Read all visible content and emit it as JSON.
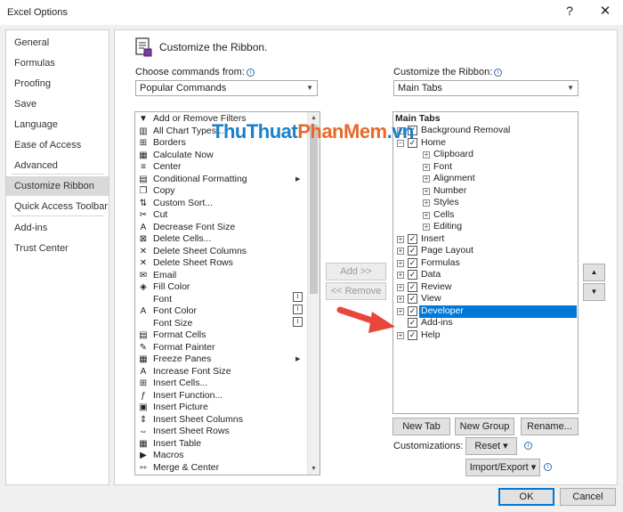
{
  "window": {
    "title": "Excel Options",
    "help_label": "?",
    "close_label": "✕"
  },
  "sidebar": {
    "items": [
      {
        "label": "General"
      },
      {
        "label": "Formulas"
      },
      {
        "label": "Proofing"
      },
      {
        "label": "Save"
      },
      {
        "label": "Language"
      },
      {
        "label": "Ease of Access"
      },
      {
        "label": "Advanced"
      },
      {
        "label": "Customize Ribbon"
      },
      {
        "label": "Quick Access Toolbar"
      },
      {
        "label": "Add-ins"
      },
      {
        "label": "Trust Center"
      }
    ],
    "selected": "Customize Ribbon"
  },
  "main": {
    "heading": "Customize the Ribbon.",
    "choose_label": "Choose commands from:",
    "choose_value": "Popular Commands",
    "customize_label": "Customize the Ribbon:",
    "customize_value": "Main Tabs",
    "commands": [
      {
        "icon": "filter-icon",
        "glyph": "▼",
        "label": "Add or Remove Filters"
      },
      {
        "icon": "chart-icon",
        "glyph": "▥",
        "label": "All Chart Types..."
      },
      {
        "icon": "borders-icon",
        "glyph": "⊞",
        "label": "Borders"
      },
      {
        "icon": "calculator-icon",
        "glyph": "▦",
        "label": "Calculate Now"
      },
      {
        "icon": "center-icon",
        "glyph": "≡",
        "label": "Center"
      },
      {
        "icon": "conditional-format-icon",
        "glyph": "▤",
        "label": "Conditional Formatting"
      },
      {
        "icon": "copy-icon",
        "glyph": "❐",
        "label": "Copy"
      },
      {
        "icon": "sort-icon",
        "glyph": "⇅",
        "label": "Custom Sort..."
      },
      {
        "icon": "cut-icon",
        "glyph": "✂",
        "label": "Cut"
      },
      {
        "icon": "decrease-font-icon",
        "glyph": "A",
        "label": "Decrease Font Size"
      },
      {
        "icon": "delete-cells-icon",
        "glyph": "⊠",
        "label": "Delete Cells..."
      },
      {
        "icon": "delete-columns-icon",
        "glyph": "✕",
        "label": "Delete Sheet Columns"
      },
      {
        "icon": "delete-rows-icon",
        "glyph": "✕",
        "label": "Delete Sheet Rows"
      },
      {
        "icon": "email-icon",
        "glyph": "✉",
        "label": "Email"
      },
      {
        "icon": "fill-color-icon",
        "glyph": "◈",
        "label": "Fill Color"
      },
      {
        "icon": "font-icon",
        "glyph": "",
        "label": "Font"
      },
      {
        "icon": "font-color-icon",
        "glyph": "A",
        "label": "Font Color"
      },
      {
        "icon": "font-size-icon",
        "glyph": "",
        "label": "Font Size"
      },
      {
        "icon": "format-cells-icon",
        "glyph": "▤",
        "label": "Format Cells"
      },
      {
        "icon": "format-painter-icon",
        "glyph": "✎",
        "label": "Format Painter"
      },
      {
        "icon": "freeze-panes-icon",
        "glyph": "▦",
        "label": "Freeze Panes"
      },
      {
        "icon": "increase-font-icon",
        "glyph": "A",
        "label": "Increase Font Size"
      },
      {
        "icon": "insert-cells-icon",
        "glyph": "⊞",
        "label": "Insert Cells..."
      },
      {
        "icon": "function-icon",
        "glyph": "ƒ",
        "label": "Insert Function..."
      },
      {
        "icon": "picture-icon",
        "glyph": "▣",
        "label": "Insert Picture"
      },
      {
        "icon": "insert-columns-icon",
        "glyph": "⇕",
        "label": "Insert Sheet Columns"
      },
      {
        "icon": "insert-rows-icon",
        "glyph": "⇔",
        "label": "Insert Sheet Rows"
      },
      {
        "icon": "table-icon",
        "glyph": "▦",
        "label": "Insert Table"
      },
      {
        "icon": "macros-icon",
        "glyph": "▶",
        "label": "Macros"
      },
      {
        "icon": "merge-center-icon",
        "glyph": "⇿",
        "label": "Merge & Center"
      }
    ],
    "add_label": "Add >>",
    "remove_label": "<< Remove",
    "tree_header": "Main Tabs",
    "tree": [
      {
        "label": "Background Removal",
        "level": 1,
        "expand": "+",
        "checked": true
      },
      {
        "label": "Home",
        "level": 1,
        "expand": "−",
        "checked": true
      },
      {
        "label": "Clipboard",
        "level": 2,
        "expand": "+"
      },
      {
        "label": "Font",
        "level": 2,
        "expand": "+"
      },
      {
        "label": "Alignment",
        "level": 2,
        "expand": "+"
      },
      {
        "label": "Number",
        "level": 2,
        "expand": "+"
      },
      {
        "label": "Styles",
        "level": 2,
        "expand": "+"
      },
      {
        "label": "Cells",
        "level": 2,
        "expand": "+"
      },
      {
        "label": "Editing",
        "level": 2,
        "expand": "+"
      },
      {
        "label": "Insert",
        "level": 1,
        "expand": "+",
        "checked": true
      },
      {
        "label": "Page Layout",
        "level": 1,
        "expand": "+",
        "checked": true
      },
      {
        "label": "Formulas",
        "level": 1,
        "expand": "+",
        "checked": true
      },
      {
        "label": "Data",
        "level": 1,
        "expand": "+",
        "checked": true
      },
      {
        "label": "Review",
        "level": 1,
        "expand": "+",
        "checked": true
      },
      {
        "label": "View",
        "level": 1,
        "expand": "+",
        "checked": true
      },
      {
        "label": "Developer",
        "level": 1,
        "expand": "+",
        "checked": true,
        "selected": true
      },
      {
        "label": "Add-ins",
        "level": 1,
        "expand": "",
        "checked": true
      },
      {
        "label": "Help",
        "level": 1,
        "expand": "+",
        "checked": true
      }
    ],
    "new_tab_label": "New Tab",
    "new_group_label": "New Group",
    "rename_label": "Rename...",
    "customizations_label": "Customizations:",
    "reset_label": "Reset ▾",
    "import_export_label": "Import/Export ▾",
    "move_up_glyph": "▲",
    "move_down_glyph": "▼"
  },
  "watermark": {
    "part1": "ThuThuat",
    "part2": "PhanMem",
    "part3": ".vn"
  },
  "footer": {
    "ok_label": "OK",
    "cancel_label": "Cancel"
  },
  "colors": {
    "accent": "#0078d7",
    "arrow": "#e8463a"
  }
}
